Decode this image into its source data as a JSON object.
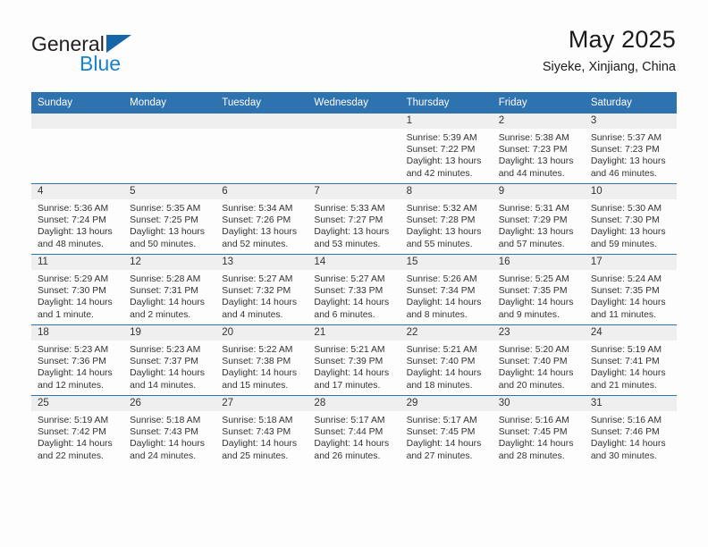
{
  "brand": {
    "name_part1": "General",
    "name_part2": "Blue",
    "logo_mark": "triangle-flag"
  },
  "header": {
    "title": "May 2025",
    "location": "Siyeke, Xinjiang, China"
  },
  "calendar": {
    "weekday_headers": [
      "Sunday",
      "Monday",
      "Tuesday",
      "Wednesday",
      "Thursday",
      "Friday",
      "Saturday"
    ],
    "accent_color": "#2e72b0",
    "daynum_band_color": "#efefef",
    "weeks": [
      [
        {
          "day": "",
          "empty": true
        },
        {
          "day": "",
          "empty": true
        },
        {
          "day": "",
          "empty": true
        },
        {
          "day": "",
          "empty": true
        },
        {
          "day": "1",
          "sunrise": "Sunrise: 5:39 AM",
          "sunset": "Sunset: 7:22 PM",
          "daylight_line1": "Daylight: 13 hours",
          "daylight_line2": "and 42 minutes."
        },
        {
          "day": "2",
          "sunrise": "Sunrise: 5:38 AM",
          "sunset": "Sunset: 7:23 PM",
          "daylight_line1": "Daylight: 13 hours",
          "daylight_line2": "and 44 minutes."
        },
        {
          "day": "3",
          "sunrise": "Sunrise: 5:37 AM",
          "sunset": "Sunset: 7:23 PM",
          "daylight_line1": "Daylight: 13 hours",
          "daylight_line2": "and 46 minutes."
        }
      ],
      [
        {
          "day": "4",
          "sunrise": "Sunrise: 5:36 AM",
          "sunset": "Sunset: 7:24 PM",
          "daylight_line1": "Daylight: 13 hours",
          "daylight_line2": "and 48 minutes."
        },
        {
          "day": "5",
          "sunrise": "Sunrise: 5:35 AM",
          "sunset": "Sunset: 7:25 PM",
          "daylight_line1": "Daylight: 13 hours",
          "daylight_line2": "and 50 minutes."
        },
        {
          "day": "6",
          "sunrise": "Sunrise: 5:34 AM",
          "sunset": "Sunset: 7:26 PM",
          "daylight_line1": "Daylight: 13 hours",
          "daylight_line2": "and 52 minutes."
        },
        {
          "day": "7",
          "sunrise": "Sunrise: 5:33 AM",
          "sunset": "Sunset: 7:27 PM",
          "daylight_line1": "Daylight: 13 hours",
          "daylight_line2": "and 53 minutes."
        },
        {
          "day": "8",
          "sunrise": "Sunrise: 5:32 AM",
          "sunset": "Sunset: 7:28 PM",
          "daylight_line1": "Daylight: 13 hours",
          "daylight_line2": "and 55 minutes."
        },
        {
          "day": "9",
          "sunrise": "Sunrise: 5:31 AM",
          "sunset": "Sunset: 7:29 PM",
          "daylight_line1": "Daylight: 13 hours",
          "daylight_line2": "and 57 minutes."
        },
        {
          "day": "10",
          "sunrise": "Sunrise: 5:30 AM",
          "sunset": "Sunset: 7:30 PM",
          "daylight_line1": "Daylight: 13 hours",
          "daylight_line2": "and 59 minutes."
        }
      ],
      [
        {
          "day": "11",
          "sunrise": "Sunrise: 5:29 AM",
          "sunset": "Sunset: 7:30 PM",
          "daylight_line1": "Daylight: 14 hours",
          "daylight_line2": "and 1 minute."
        },
        {
          "day": "12",
          "sunrise": "Sunrise: 5:28 AM",
          "sunset": "Sunset: 7:31 PM",
          "daylight_line1": "Daylight: 14 hours",
          "daylight_line2": "and 2 minutes."
        },
        {
          "day": "13",
          "sunrise": "Sunrise: 5:27 AM",
          "sunset": "Sunset: 7:32 PM",
          "daylight_line1": "Daylight: 14 hours",
          "daylight_line2": "and 4 minutes."
        },
        {
          "day": "14",
          "sunrise": "Sunrise: 5:27 AM",
          "sunset": "Sunset: 7:33 PM",
          "daylight_line1": "Daylight: 14 hours",
          "daylight_line2": "and 6 minutes."
        },
        {
          "day": "15",
          "sunrise": "Sunrise: 5:26 AM",
          "sunset": "Sunset: 7:34 PM",
          "daylight_line1": "Daylight: 14 hours",
          "daylight_line2": "and 8 minutes."
        },
        {
          "day": "16",
          "sunrise": "Sunrise: 5:25 AM",
          "sunset": "Sunset: 7:35 PM",
          "daylight_line1": "Daylight: 14 hours",
          "daylight_line2": "and 9 minutes."
        },
        {
          "day": "17",
          "sunrise": "Sunrise: 5:24 AM",
          "sunset": "Sunset: 7:35 PM",
          "daylight_line1": "Daylight: 14 hours",
          "daylight_line2": "and 11 minutes."
        }
      ],
      [
        {
          "day": "18",
          "sunrise": "Sunrise: 5:23 AM",
          "sunset": "Sunset: 7:36 PM",
          "daylight_line1": "Daylight: 14 hours",
          "daylight_line2": "and 12 minutes."
        },
        {
          "day": "19",
          "sunrise": "Sunrise: 5:23 AM",
          "sunset": "Sunset: 7:37 PM",
          "daylight_line1": "Daylight: 14 hours",
          "daylight_line2": "and 14 minutes."
        },
        {
          "day": "20",
          "sunrise": "Sunrise: 5:22 AM",
          "sunset": "Sunset: 7:38 PM",
          "daylight_line1": "Daylight: 14 hours",
          "daylight_line2": "and 15 minutes."
        },
        {
          "day": "21",
          "sunrise": "Sunrise: 5:21 AM",
          "sunset": "Sunset: 7:39 PM",
          "daylight_line1": "Daylight: 14 hours",
          "daylight_line2": "and 17 minutes."
        },
        {
          "day": "22",
          "sunrise": "Sunrise: 5:21 AM",
          "sunset": "Sunset: 7:40 PM",
          "daylight_line1": "Daylight: 14 hours",
          "daylight_line2": "and 18 minutes."
        },
        {
          "day": "23",
          "sunrise": "Sunrise: 5:20 AM",
          "sunset": "Sunset: 7:40 PM",
          "daylight_line1": "Daylight: 14 hours",
          "daylight_line2": "and 20 minutes."
        },
        {
          "day": "24",
          "sunrise": "Sunrise: 5:19 AM",
          "sunset": "Sunset: 7:41 PM",
          "daylight_line1": "Daylight: 14 hours",
          "daylight_line2": "and 21 minutes."
        }
      ],
      [
        {
          "day": "25",
          "sunrise": "Sunrise: 5:19 AM",
          "sunset": "Sunset: 7:42 PM",
          "daylight_line1": "Daylight: 14 hours",
          "daylight_line2": "and 22 minutes."
        },
        {
          "day": "26",
          "sunrise": "Sunrise: 5:18 AM",
          "sunset": "Sunset: 7:43 PM",
          "daylight_line1": "Daylight: 14 hours",
          "daylight_line2": "and 24 minutes."
        },
        {
          "day": "27",
          "sunrise": "Sunrise: 5:18 AM",
          "sunset": "Sunset: 7:43 PM",
          "daylight_line1": "Daylight: 14 hours",
          "daylight_line2": "and 25 minutes."
        },
        {
          "day": "28",
          "sunrise": "Sunrise: 5:17 AM",
          "sunset": "Sunset: 7:44 PM",
          "daylight_line1": "Daylight: 14 hours",
          "daylight_line2": "and 26 minutes."
        },
        {
          "day": "29",
          "sunrise": "Sunrise: 5:17 AM",
          "sunset": "Sunset: 7:45 PM",
          "daylight_line1": "Daylight: 14 hours",
          "daylight_line2": "and 27 minutes."
        },
        {
          "day": "30",
          "sunrise": "Sunrise: 5:16 AM",
          "sunset": "Sunset: 7:45 PM",
          "daylight_line1": "Daylight: 14 hours",
          "daylight_line2": "and 28 minutes."
        },
        {
          "day": "31",
          "sunrise": "Sunrise: 5:16 AM",
          "sunset": "Sunset: 7:46 PM",
          "daylight_line1": "Daylight: 14 hours",
          "daylight_line2": "and 30 minutes."
        }
      ]
    ]
  }
}
